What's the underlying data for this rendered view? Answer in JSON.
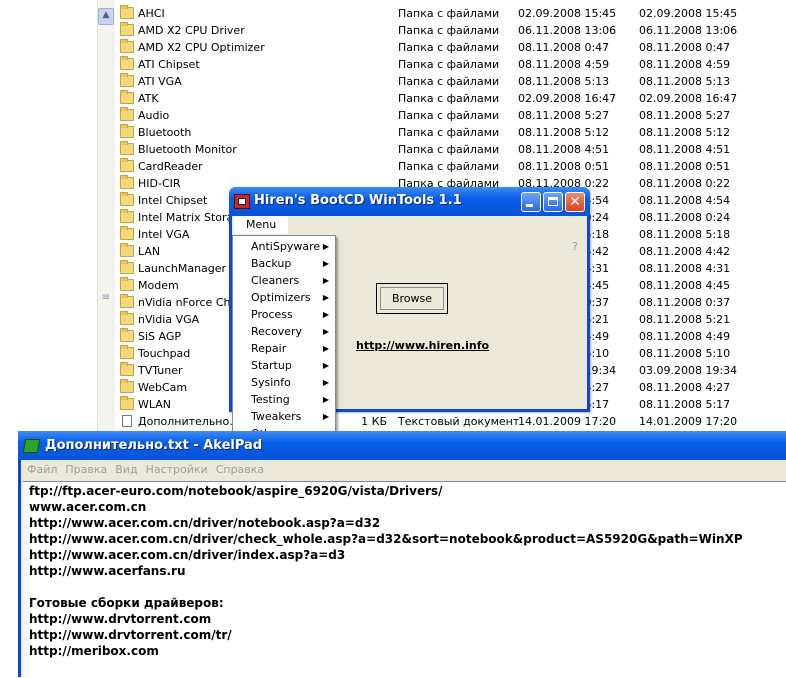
{
  "explorer": {
    "rows": [
      {
        "name": "AHCI",
        "size": "",
        "type": "Папка с файлами",
        "modified": "02.09.2008 15:45",
        "created": "02.09.2008 15:45"
      },
      {
        "name": "AMD X2 CPU Driver",
        "size": "",
        "type": "Папка с файлами",
        "modified": "06.11.2008 13:06",
        "created": "06.11.2008 13:06"
      },
      {
        "name": "AMD X2 CPU Optimizer",
        "size": "",
        "type": "Папка с файлами",
        "modified": "08.11.2008 0:47",
        "created": "08.11.2008 0:47"
      },
      {
        "name": "ATI Chipset",
        "size": "",
        "type": "Папка с файлами",
        "modified": "08.11.2008 4:59",
        "created": "08.11.2008 4:59"
      },
      {
        "name": "ATI VGA",
        "size": "",
        "type": "Папка с файлами",
        "modified": "08.11.2008 5:13",
        "created": "08.11.2008 5:13"
      },
      {
        "name": "ATK",
        "size": "",
        "type": "Папка с файлами",
        "modified": "02.09.2008 16:47",
        "created": "02.09.2008 16:47"
      },
      {
        "name": "Audio",
        "size": "",
        "type": "Папка с файлами",
        "modified": "08.11.2008 5:27",
        "created": "08.11.2008 5:27"
      },
      {
        "name": "Bluetooth",
        "size": "",
        "type": "Папка с файлами",
        "modified": "08.11.2008 5:12",
        "created": "08.11.2008 5:12"
      },
      {
        "name": "Bluetooth Monitor",
        "size": "",
        "type": "Папка с файлами",
        "modified": "08.11.2008 4:51",
        "created": "08.11.2008 4:51"
      },
      {
        "name": "CardReader",
        "size": "",
        "type": "Папка с файлами",
        "modified": "08.11.2008 0:51",
        "created": "08.11.2008 0:51"
      },
      {
        "name": "HID-CIR",
        "size": "",
        "type": "Папка с файлами",
        "modified": "08.11.2008 0:22",
        "created": "08.11.2008 0:22"
      },
      {
        "name": "Intel Chipset",
        "size": "",
        "type": "",
        "modified": "08.11.2008 4:54",
        "created": "08.11.2008 4:54"
      },
      {
        "name": "Intel Matrix Storage",
        "size": "",
        "type": "",
        "modified": "08.11.2008 0:24",
        "created": "08.11.2008 0:24"
      },
      {
        "name": "Intel VGA",
        "size": "",
        "type": "",
        "modified": "08.11.2008 5:18",
        "created": "08.11.2008 5:18"
      },
      {
        "name": "LAN",
        "size": "",
        "type": "",
        "modified": "08.11.2008 4:42",
        "created": "08.11.2008 4:42"
      },
      {
        "name": "LaunchManager",
        "size": "",
        "type": "",
        "modified": "08.11.2008 4:31",
        "created": "08.11.2008 4:31"
      },
      {
        "name": "Modem",
        "size": "",
        "type": "",
        "modified": "08.11.2008 4:45",
        "created": "08.11.2008 4:45"
      },
      {
        "name": "nVidia nForce Chipset",
        "size": "",
        "type": "",
        "modified": "08.11.2008 0:37",
        "created": "08.11.2008 0:37"
      },
      {
        "name": "nVidia VGA",
        "size": "",
        "type": "",
        "modified": "08.11.2008 5:21",
        "created": "08.11.2008 5:21"
      },
      {
        "name": "SiS AGP",
        "size": "",
        "type": "",
        "modified": "08.11.2008 4:49",
        "created": "08.11.2008 4:49"
      },
      {
        "name": "Touchpad",
        "size": "",
        "type": "",
        "modified": "08.11.2008 5:10",
        "created": "08.11.2008 5:10"
      },
      {
        "name": "TVTuner",
        "size": "",
        "type": "",
        "modified": "03.09.2008 19:34",
        "created": "03.09.2008 19:34"
      },
      {
        "name": "WebCam",
        "size": "",
        "type": "",
        "modified": "08.11.2008 4:27",
        "created": "08.11.2008 4:27"
      },
      {
        "name": "WLAN",
        "size": "",
        "type": "",
        "modified": "08.11.2008 5:17",
        "created": "08.11.2008 5:17"
      },
      {
        "name": "Дополнительно.txt",
        "size": "1 КБ",
        "type": "Текстовый документ",
        "modified": "14.01.2009 17:20",
        "created": "14.01.2009 17:20"
      }
    ]
  },
  "hiren": {
    "title": "Hiren's BootCD WinTools 1.1",
    "menu_label": "Menu",
    "help": "?",
    "browse_label": "Browse",
    "link": "http://www.hiren.info",
    "menu_items": [
      "AntiSpyware",
      "Backup",
      "Cleaners",
      "Optimizers",
      "Process",
      "Recovery",
      "Repair",
      "Startup",
      "Sysinfo",
      "Testing",
      "Tweakers",
      "Other"
    ]
  },
  "akelpad": {
    "title": "Дополнительно.txt - AkelPad",
    "menu": [
      "Файл",
      "Правка",
      "Вид",
      "Настройки",
      "Справка"
    ],
    "lines": [
      "ftp://ftp.acer-euro.com/notebook/aspire_6920G/vista/Drivers/",
      "www.acer.com.cn",
      "http://www.acer.com.cn/driver/notebook.asp?a=d32",
      "http://www.acer.com.cn/driver/check_whole.asp?a=d32&sort=notebook&product=AS5920G&path=WinXP",
      "http://www.acer.com.cn/driver/index.asp?a=d3",
      "http://www.acerfans.ru",
      "",
      "Готовые сборки драйверов:",
      "http://www.drvtorrent.com",
      "http://www.drvtorrent.com/tr/",
      "http://meribox.com"
    ]
  },
  "colors": {
    "titlebar": "#0a5ee6",
    "face": "#ece9d8",
    "close": "#e2562e"
  }
}
